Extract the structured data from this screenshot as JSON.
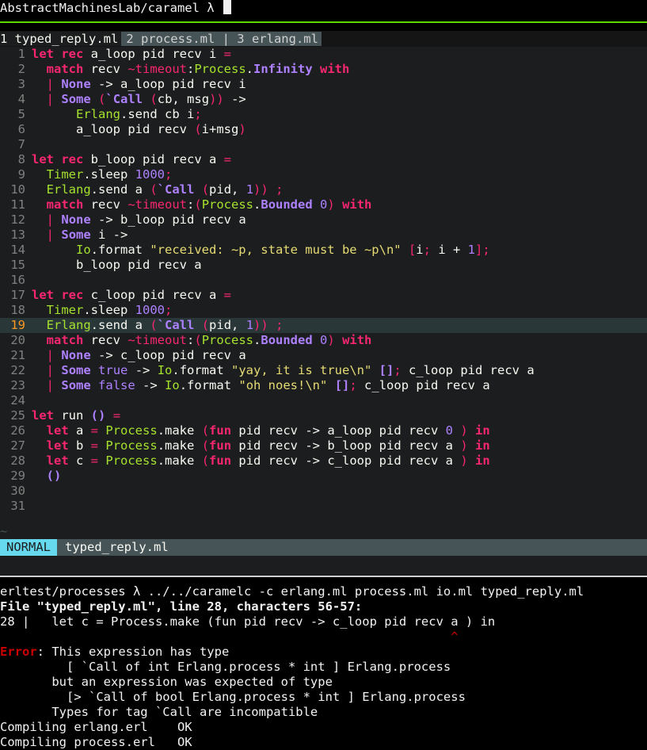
{
  "top_prompt": "AbstractMachinesLab/caramel λ",
  "tabs": [
    {
      "label": "1 typed_reply.ml",
      "active": true
    },
    {
      "label": "2 process.ml | 3 erlang.ml",
      "active": false
    }
  ],
  "editor": {
    "current_line": 19,
    "line_numbers": [
      "1",
      "2",
      "3",
      "4",
      "5",
      "6",
      "7",
      "8",
      "9",
      "10",
      "11",
      "12",
      "13",
      "14",
      "15",
      "16",
      "17",
      "18",
      "19",
      "20",
      "21",
      "22",
      "23",
      "24",
      "25",
      "26",
      "27",
      "28",
      "29",
      "30",
      "31"
    ],
    "tilde": "~"
  },
  "statusline": {
    "mode": "NORMAL",
    "file": "typed_reply.ml"
  },
  "terminal": {
    "command_line": "erltest/processes λ ../../caramelc -c erlang.ml process.ml io.ml typed_reply.ml",
    "file_location": "File \"typed_reply.ml\", line 28, characters 56-57:",
    "source_line": "28 |   let c = Process.make (fun pid recv -> c_loop pid recv a ) in",
    "caret_line": "                                                             ^",
    "error_label": "Error",
    "error_rest": ": This expression has type",
    "error_lines": [
      "         [ `Call of int Erlang.process * int ] Erlang.process",
      "       but an expression was expected of type",
      "         [> `Call of bool Erlang.process * int ] Erlang.process",
      "       Types for tag `Call are incompatible",
      "Compiling erlang.erl    OK",
      "Compiling process.erl   OK"
    ]
  }
}
